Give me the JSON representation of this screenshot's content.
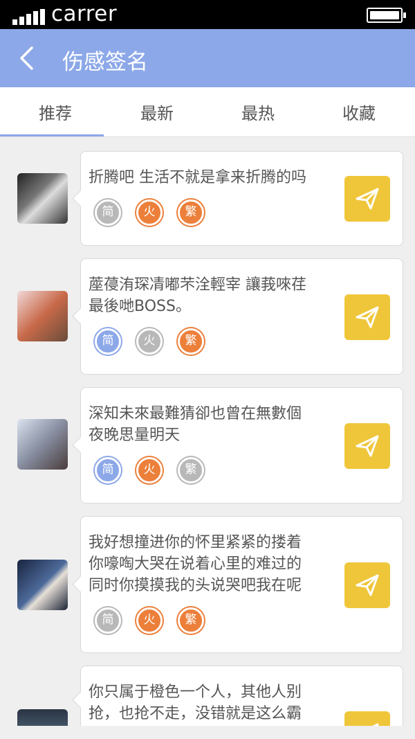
{
  "status": {
    "carrier": "carrer"
  },
  "header": {
    "title": "伤感签名",
    "back_icon": "chevron-left-icon"
  },
  "tabs": [
    {
      "label": "推荐",
      "active": true
    },
    {
      "label": "最新",
      "active": false
    },
    {
      "label": "最热",
      "active": false
    },
    {
      "label": "收藏",
      "active": false
    }
  ],
  "badge_labels": {
    "simplified": "简",
    "fire": "火",
    "traditional": "繁"
  },
  "colors": {
    "accent": "#8ca8e8",
    "orange": "#ec7f3a",
    "gray": "#b8b8b8",
    "send": "#efc63a"
  },
  "items": [
    {
      "lines": [
        "折腾吧 生活不就是拿来折腾的吗"
      ],
      "active_badges": [
        "fire",
        "traditional"
      ],
      "avatar": "avatar-photo"
    },
    {
      "lines": [
        "蓙葠洧琛凊嘟芣洤輕宰 讓莪唻荏",
        "最後哋BOSS。"
      ],
      "active_badges": [
        "simplified",
        "traditional"
      ],
      "avatar": "avatar-photo"
    },
    {
      "lines": [
        "深知未來最難猜卻也曾在無數個",
        "夜晚思量明天"
      ],
      "active_badges": [
        "simplified",
        "fire"
      ],
      "avatar": "avatar-photo"
    },
    {
      "lines": [
        "我好想撞进你的怀里紧紧的搂着",
        "你嚎啕大哭在说着心里的难过的",
        "同时你摸摸我的头说哭吧我在呢"
      ],
      "active_badges": [
        "fire",
        "traditional"
      ],
      "avatar": "avatar-photo"
    },
    {
      "lines": [
        "你只属于橙色一个人，其他人别",
        "抢，也抢不走，没错就是这么霸"
      ],
      "active_badges": [],
      "avatar": "avatar-photo"
    }
  ]
}
